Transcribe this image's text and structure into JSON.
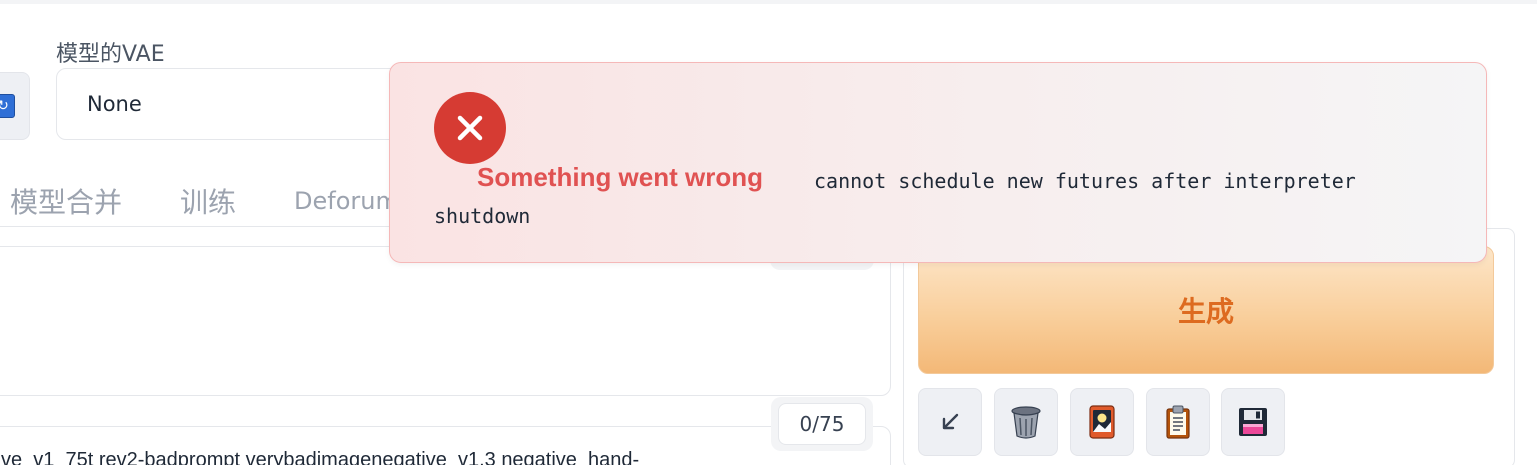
{
  "vae": {
    "label": "模型的VAE",
    "value": "None"
  },
  "tabs": [
    {
      "label": "模型合并"
    },
    {
      "label": "训练"
    },
    {
      "label": "Deforum"
    }
  ],
  "negative_prompt": {
    "text": "ve_v1_75t rev2-badprompt verybadimagenegative_v1.3 negative_hand-",
    "counter": "0/75"
  },
  "generate": {
    "label": "生成",
    "color": "#dd6b20"
  },
  "tools": [
    {
      "icon": "arrow-down-left-icon"
    },
    {
      "icon": "trash-icon"
    },
    {
      "icon": "image-card-icon"
    },
    {
      "icon": "clipboard-icon"
    },
    {
      "icon": "floppy-disk-icon"
    }
  ],
  "error_toast": {
    "title": "Something went wrong",
    "message_line1": "cannot schedule new futures after interpreter",
    "message_line2": "shutdown",
    "accent_color": "#d63b33"
  }
}
